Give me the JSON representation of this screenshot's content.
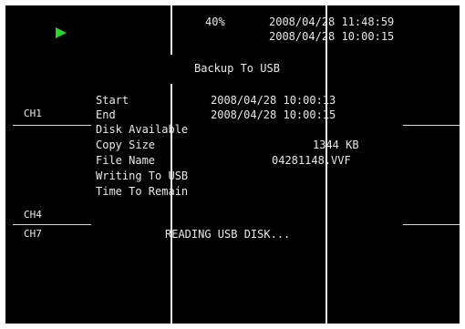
{
  "status": {
    "play_icon": "play-icon",
    "play_color": "#2bd62b",
    "progress": "40%",
    "datetime_1": "2008/04/28 11:48:59",
    "datetime_2": "2008/04/28 10:00:15"
  },
  "backup": {
    "title": "Backup To USB",
    "rows": [
      {
        "label": "Start",
        "value": "2008/04/28 10:00:13"
      },
      {
        "label": "End",
        "value": "2008/04/28 10:00:15"
      },
      {
        "label": "Disk Available",
        "value": ""
      },
      {
        "label": "Copy Size",
        "value": "1344 KB"
      },
      {
        "label": "File Name",
        "value": "04281148.VVF"
      },
      {
        "label": "Writing To USB",
        "value": ""
      },
      {
        "label": "Time To Remain",
        "value": ""
      }
    ],
    "message": "READING USB DISK..."
  },
  "channels": [
    "CH1",
    "CH4",
    "CH7"
  ]
}
